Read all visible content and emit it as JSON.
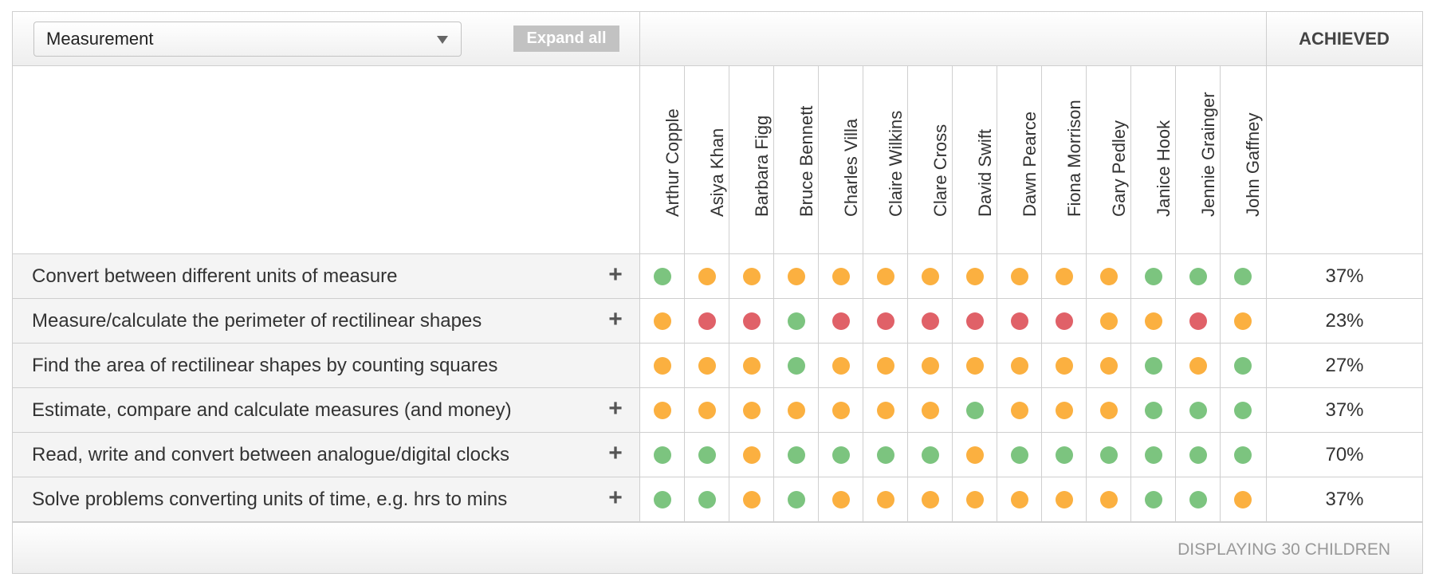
{
  "toolbar": {
    "select_value": "Measurement",
    "expand_label": "Expand all",
    "achieved_label": "ACHIEVED"
  },
  "colors": {
    "green": "#7cc47f",
    "amber": "#fbb040",
    "red": "#e06168"
  },
  "children": [
    "Arthur Copple",
    "Asiya Khan",
    "Barbara Figg",
    "Bruce Bennett",
    "Charles Villa",
    "Claire Wilkins",
    "Clare Cross",
    "David Swift",
    "Dawn Pearce",
    "Fiona Morrison",
    "Gary Pedley",
    "Janice Hook",
    "Jennie Grainger",
    "John Gaffney"
  ],
  "objectives": [
    {
      "label": "Convert between different units of measure",
      "expandable": true,
      "percent": "37%",
      "status": [
        "green",
        "amber",
        "amber",
        "amber",
        "amber",
        "amber",
        "amber",
        "amber",
        "amber",
        "amber",
        "amber",
        "green",
        "green",
        "green"
      ]
    },
    {
      "label": "Measure/calculate the perimeter of rectilinear shapes",
      "expandable": true,
      "percent": "23%",
      "status": [
        "amber",
        "red",
        "red",
        "green",
        "red",
        "red",
        "red",
        "red",
        "red",
        "red",
        "amber",
        "amber",
        "red",
        "amber"
      ]
    },
    {
      "label": "Find the area of rectilinear shapes by counting squares",
      "expandable": false,
      "percent": "27%",
      "status": [
        "amber",
        "amber",
        "amber",
        "green",
        "amber",
        "amber",
        "amber",
        "amber",
        "amber",
        "amber",
        "amber",
        "green",
        "amber",
        "green"
      ]
    },
    {
      "label": "Estimate, compare and calculate measures (and money)",
      "expandable": true,
      "percent": "37%",
      "status": [
        "amber",
        "amber",
        "amber",
        "amber",
        "amber",
        "amber",
        "amber",
        "green",
        "amber",
        "amber",
        "amber",
        "green",
        "green",
        "green"
      ]
    },
    {
      "label": "Read, write and convert between analogue/digital clocks",
      "expandable": true,
      "percent": "70%",
      "status": [
        "green",
        "green",
        "amber",
        "green",
        "green",
        "green",
        "green",
        "amber",
        "green",
        "green",
        "green",
        "green",
        "green",
        "green"
      ]
    },
    {
      "label": "Solve problems converting units of time, e.g. hrs to mins",
      "expandable": true,
      "percent": "37%",
      "status": [
        "green",
        "green",
        "amber",
        "green",
        "amber",
        "amber",
        "amber",
        "amber",
        "amber",
        "amber",
        "amber",
        "green",
        "green",
        "amber"
      ]
    }
  ],
  "footer": {
    "status_text": "DISPLAYING 30 CHILDREN"
  }
}
